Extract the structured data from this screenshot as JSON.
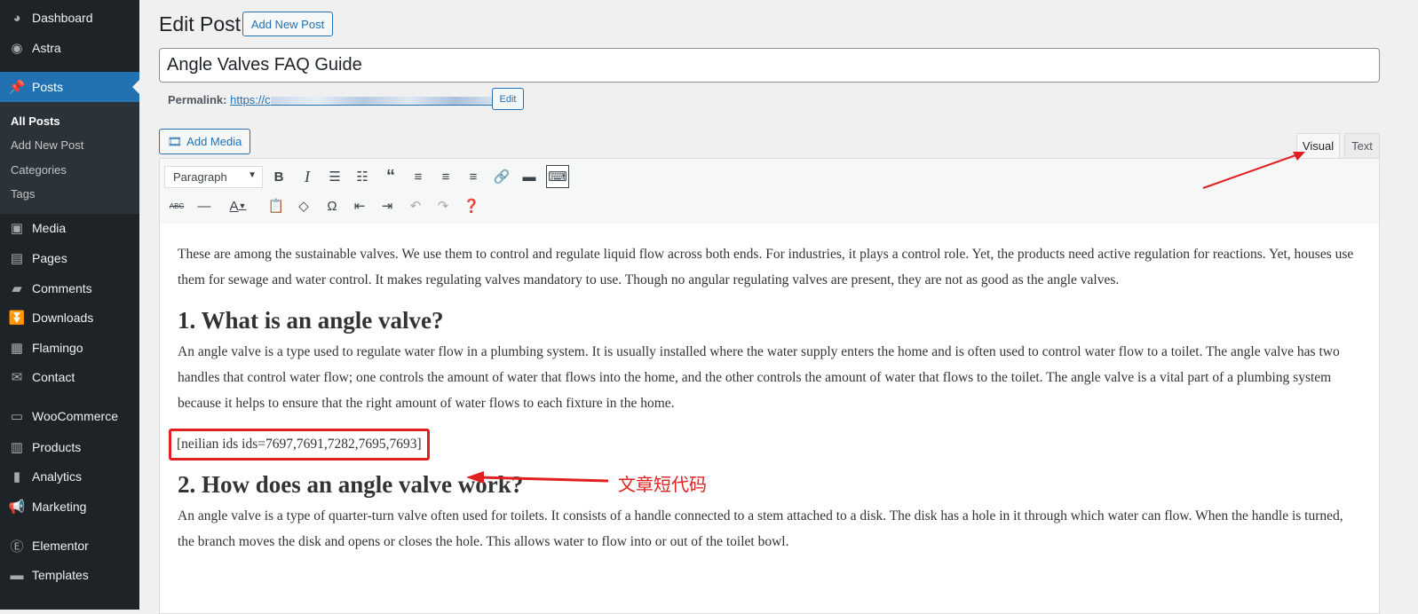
{
  "sidebar": {
    "items": [
      {
        "label": "Dashboard",
        "icon": "dashboard-icon"
      },
      {
        "label": "Astra",
        "icon": "astra-icon"
      },
      {
        "label": "Posts",
        "icon": "pin-icon"
      },
      {
        "label": "Media",
        "icon": "media-icon"
      },
      {
        "label": "Pages",
        "icon": "pages-icon"
      },
      {
        "label": "Comments",
        "icon": "comments-icon"
      },
      {
        "label": "Downloads",
        "icon": "downloads-icon"
      },
      {
        "label": "Flamingo",
        "icon": "flamingo-icon"
      },
      {
        "label": "Contact",
        "icon": "mail-icon"
      },
      {
        "label": "WooCommerce",
        "icon": "woocommerce-icon"
      },
      {
        "label": "Products",
        "icon": "products-icon"
      },
      {
        "label": "Analytics",
        "icon": "analytics-icon"
      },
      {
        "label": "Marketing",
        "icon": "megaphone-icon"
      },
      {
        "label": "Elementor",
        "icon": "elementor-icon"
      },
      {
        "label": "Templates",
        "icon": "folder-icon"
      }
    ],
    "submenu": [
      "All Posts",
      "Add New Post",
      "Categories",
      "Tags"
    ]
  },
  "header": {
    "title": "Edit Post",
    "add_new": "Add New Post"
  },
  "post": {
    "title": "Angle Valves FAQ Guide",
    "permalink_label": "Permalink:",
    "permalink_visible": "https://c",
    "permalink_end": "/",
    "edit": "Edit"
  },
  "editor": {
    "add_media": "Add Media",
    "tab_visual": "Visual",
    "tab_text": "Text",
    "format": "Paragraph",
    "content": {
      "p1": "These are among the sustainable valves. We use them to control and regulate liquid flow across both ends. For industries, it plays a control role. Yet, the products need active regulation for reactions. Yet, houses use them for sewage and water control. It makes regulating valves mandatory to use. Though no angular regulating valves are present, they are not as good as the angle valves.",
      "h1": "1. What is an angle valve?",
      "p2": "An angle valve is a type used to regulate water flow in a plumbing system. It is usually installed where the water supply enters the home and is often used to control water flow to a toilet. The angle valve has two handles that control water flow; one controls the amount of water that flows into the home, and the other controls the amount of water that flows to the toilet. The angle valve is a vital part of a plumbing system because it helps to ensure that the right amount of water flows to each fixture in the home.",
      "shortcode": "[neilian ids ids=7697,7691,7282,7695,7693]",
      "h2": "2.  How does an angle valve work?",
      "p3": "An angle valve is a type of quarter-turn valve often used for toilets. It consists of a handle connected to a stem attached to a disk. The disk has a hole in it through which water can flow. When the handle is turned, the branch moves the disk and opens or closes the hole. This allows water to flow into or out of the toilet bowl."
    }
  },
  "annotation": {
    "label": "文章短代码",
    "color": "#e02020"
  },
  "colors": {
    "sidebar": "#1d2327",
    "accent": "#2271b1"
  }
}
